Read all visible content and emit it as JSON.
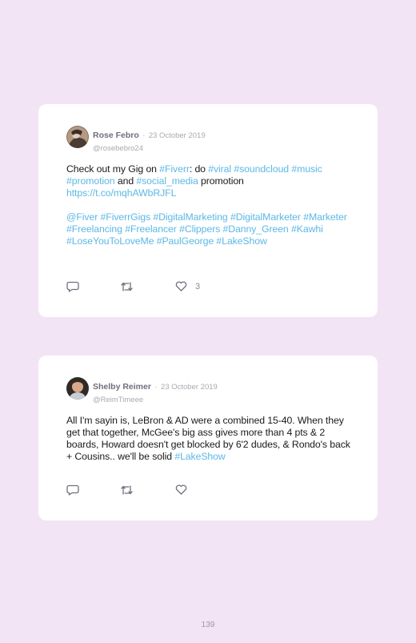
{
  "tweets": [
    {
      "name": "Rose Febro",
      "separator": "·",
      "date": "23 October 2019",
      "handle": "@rosebebro24",
      "body_parts": [
        {
          "t": "Check out my Gig on "
        },
        {
          "t": "#Fiverr",
          "tag": true
        },
        {
          "t": ": do "
        },
        {
          "t": "#viral",
          "tag": true
        },
        {
          "t": " "
        },
        {
          "t": "#soundcloud",
          "tag": true
        },
        {
          "t": " "
        },
        {
          "t": "#music",
          "tag": true
        },
        {
          "t": " "
        },
        {
          "t": "#promotion",
          "tag": true
        },
        {
          "t": " and "
        },
        {
          "t": "#social_media",
          "tag": true
        },
        {
          "t": " promotion "
        },
        {
          "t": "https://t.co/mqhAWbRJFL",
          "tag": true
        },
        {
          "br": true
        },
        {
          "t": "@Fiver",
          "tag": true
        },
        {
          "t": " "
        },
        {
          "t": "#FiverrGigs",
          "tag": true
        },
        {
          "t": " "
        },
        {
          "t": "#DigitalMarketing",
          "tag": true
        },
        {
          "t": " "
        },
        {
          "t": "#DigitalMarketer",
          "tag": true
        },
        {
          "t": " "
        },
        {
          "t": "#Marketer",
          "tag": true
        },
        {
          "t": " "
        },
        {
          "t": "#Freelancing",
          "tag": true
        },
        {
          "t": " "
        },
        {
          "t": "#Freelancer",
          "tag": true
        },
        {
          "t": " "
        },
        {
          "t": "#Clippers",
          "tag": true
        },
        {
          "t": " "
        },
        {
          "t": "#Danny_Green",
          "tag": true
        },
        {
          "t": " "
        },
        {
          "t": "#Kawhi",
          "tag": true
        },
        {
          "t": " "
        },
        {
          "t": "#LoseYouToLoveMe",
          "tag": true
        },
        {
          "t": " "
        },
        {
          "t": "#PaulGeorge",
          "tag": true
        },
        {
          "t": " "
        },
        {
          "t": "#LakeShow",
          "tag": true
        }
      ],
      "like_count": "3",
      "icons": [
        "reply-icon",
        "retweet-icon",
        "heart-icon"
      ]
    },
    {
      "name": "Shelby Reimer",
      "separator": "·",
      "date": "23 October 2019",
      "handle": "@ReimTimeee",
      "body_parts": [
        {
          "t": "All I'm sayin is, LeBron & AD were a combined 15-40. When they get that together, McGee's big ass gives more than 4 pts & 2 boards, Howard doesn't get blocked by 6'2 dudes, & Rondo's back + Cousins.. we'll be solid "
        },
        {
          "t": "#LakeShow",
          "tag": true
        }
      ],
      "like_count": "",
      "icons": [
        "reply-icon",
        "retweet-icon",
        "heart-icon"
      ]
    }
  ],
  "page_number": "139",
  "colors": {
    "background": "#f2e4f5",
    "hashtag": "#5cb8e6",
    "muted": "#a9a9b2"
  }
}
